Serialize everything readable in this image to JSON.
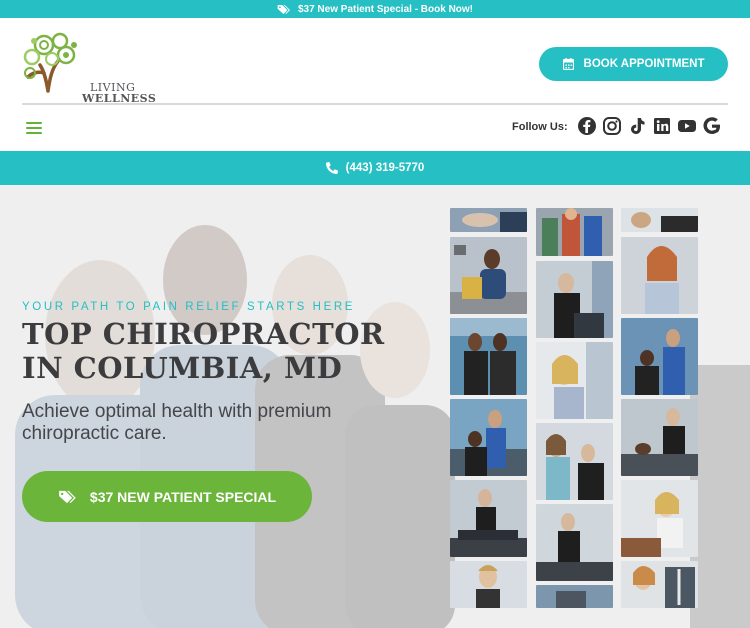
{
  "promo_bar": {
    "text": "$37 New Patient Special - Book Now!",
    "icon": "tags-icon"
  },
  "header": {
    "logo": {
      "line1": "LIVING",
      "line2": "WELLNESS",
      "icon": "tree-logo"
    },
    "book_button": {
      "label": "BOOK APPOINTMENT",
      "icon": "calendar-icon"
    },
    "menu_icon": "hamburger-icon",
    "follow_label": "Follow Us:",
    "social_icons": [
      "facebook-icon",
      "instagram-icon",
      "tiktok-icon",
      "linkedin-icon",
      "youtube-icon",
      "google-icon"
    ]
  },
  "phone_bar": {
    "phone": "(443) 319-5770",
    "icon": "phone-icon"
  },
  "hero": {
    "tagline": "YOUR PATH TO PAIN RELIEF STARTS HERE",
    "headline_line1": "TOP CHIROPRACTOR",
    "headline_line2": "IN COLUMBIA, MD",
    "subtitle": "Achieve optimal health with premium chiropractic care.",
    "cta": {
      "label": "$37 NEW PATIENT SPECIAL",
      "icon": "tags-icon"
    }
  },
  "colors": {
    "teal": "#25bfc4",
    "green": "#6bb53a",
    "dark_text": "#3c3c3f",
    "hero_bg": "#efeff0"
  }
}
